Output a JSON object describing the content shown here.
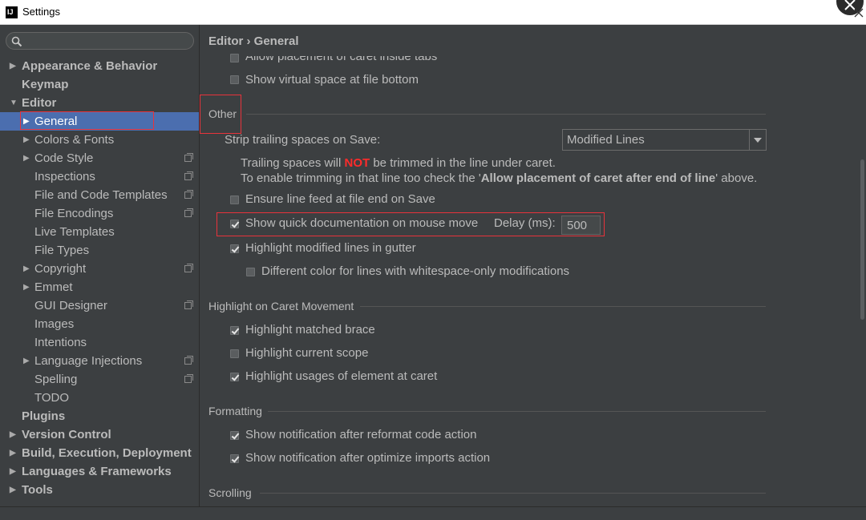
{
  "window": {
    "title": "Settings",
    "app_icon_text": "IJ"
  },
  "search": {
    "placeholder": ""
  },
  "sidebar": {
    "items": [
      {
        "label": "Appearance & Behavior",
        "bold": true,
        "arrow": "right",
        "level": 0
      },
      {
        "label": "Keymap",
        "bold": true,
        "arrow": "",
        "level": 0
      },
      {
        "label": "Editor",
        "bold": true,
        "arrow": "down",
        "level": 0
      },
      {
        "label": "General",
        "bold": false,
        "arrow": "right",
        "level": 1,
        "selected": true
      },
      {
        "label": "Colors & Fonts",
        "bold": false,
        "arrow": "right",
        "level": 1
      },
      {
        "label": "Code Style",
        "bold": false,
        "arrow": "right",
        "level": 1,
        "project_icon": true
      },
      {
        "label": "Inspections",
        "bold": false,
        "arrow": "",
        "level": 1,
        "project_icon": true
      },
      {
        "label": "File and Code Templates",
        "bold": false,
        "arrow": "",
        "level": 1,
        "project_icon": true
      },
      {
        "label": "File Encodings",
        "bold": false,
        "arrow": "",
        "level": 1,
        "project_icon": true
      },
      {
        "label": "Live Templates",
        "bold": false,
        "arrow": "",
        "level": 1
      },
      {
        "label": "File Types",
        "bold": false,
        "arrow": "",
        "level": 1
      },
      {
        "label": "Copyright",
        "bold": false,
        "arrow": "right",
        "level": 1,
        "project_icon": true
      },
      {
        "label": "Emmet",
        "bold": false,
        "arrow": "right",
        "level": 1
      },
      {
        "label": "GUI Designer",
        "bold": false,
        "arrow": "",
        "level": 1,
        "project_icon": true
      },
      {
        "label": "Images",
        "bold": false,
        "arrow": "",
        "level": 1
      },
      {
        "label": "Intentions",
        "bold": false,
        "arrow": "",
        "level": 1
      },
      {
        "label": "Language Injections",
        "bold": false,
        "arrow": "right",
        "level": 1,
        "project_icon": true
      },
      {
        "label": "Spelling",
        "bold": false,
        "arrow": "",
        "level": 1,
        "project_icon": true
      },
      {
        "label": "TODO",
        "bold": false,
        "arrow": "",
        "level": 1
      },
      {
        "label": "Plugins",
        "bold": true,
        "arrow": "",
        "level": 0
      },
      {
        "label": "Version Control",
        "bold": true,
        "arrow": "right",
        "level": 0
      },
      {
        "label": "Build, Execution, Deployment",
        "bold": true,
        "arrow": "right",
        "level": 0
      },
      {
        "label": "Languages & Frameworks",
        "bold": true,
        "arrow": "right",
        "level": 0
      },
      {
        "label": "Tools",
        "bold": true,
        "arrow": "right",
        "level": 0
      }
    ]
  },
  "breadcrumb": {
    "text": "Editor › General"
  },
  "main": {
    "top_options": [
      {
        "label": "Allow placement of caret inside tabs",
        "checked": false
      },
      {
        "label": "Show virtual space at file bottom",
        "checked": false
      }
    ],
    "other": {
      "title": "Other",
      "strip_label": "Strip trailing spaces on Save:",
      "strip_value": "Modified Lines",
      "note_line1_pre": "Trailing spaces will ",
      "note_line1_not": "NOT",
      "note_line1_post": " be trimmed in the line under caret.",
      "note_line2_pre": "To enable trimming in that line too check the '",
      "note_line2_bold": "Allow placement of caret after end of line",
      "note_line2_post": "' above.",
      "ensure_line_feed": {
        "label": "Ensure line feed at file end on Save",
        "checked": false
      },
      "quick_doc": {
        "label": "Show quick documentation on mouse move",
        "checked": true
      },
      "delay_label": "Delay (ms):",
      "delay_value": "500",
      "highlight_modified": {
        "label": "Highlight modified lines in gutter",
        "checked": true
      },
      "different_color": {
        "label": "Different color for lines with whitespace-only modifications",
        "checked": false
      }
    },
    "caret": {
      "title": "Highlight on Caret Movement",
      "matched_brace": {
        "label": "Highlight matched brace",
        "checked": true
      },
      "current_scope": {
        "label": "Highlight current scope",
        "checked": false
      },
      "usages": {
        "label": "Highlight usages of element at caret",
        "checked": true
      }
    },
    "formatting": {
      "title": "Formatting",
      "reformat": {
        "label": "Show notification after reformat code action",
        "checked": true
      },
      "optimize": {
        "label": "Show notification after optimize imports action",
        "checked": true
      }
    },
    "scrolling": {
      "title": "Scrolling"
    }
  },
  "colors": {
    "accent": "#4b6eaf",
    "highlight_border": "#e8333b",
    "not_text": "#ff2b2b"
  }
}
